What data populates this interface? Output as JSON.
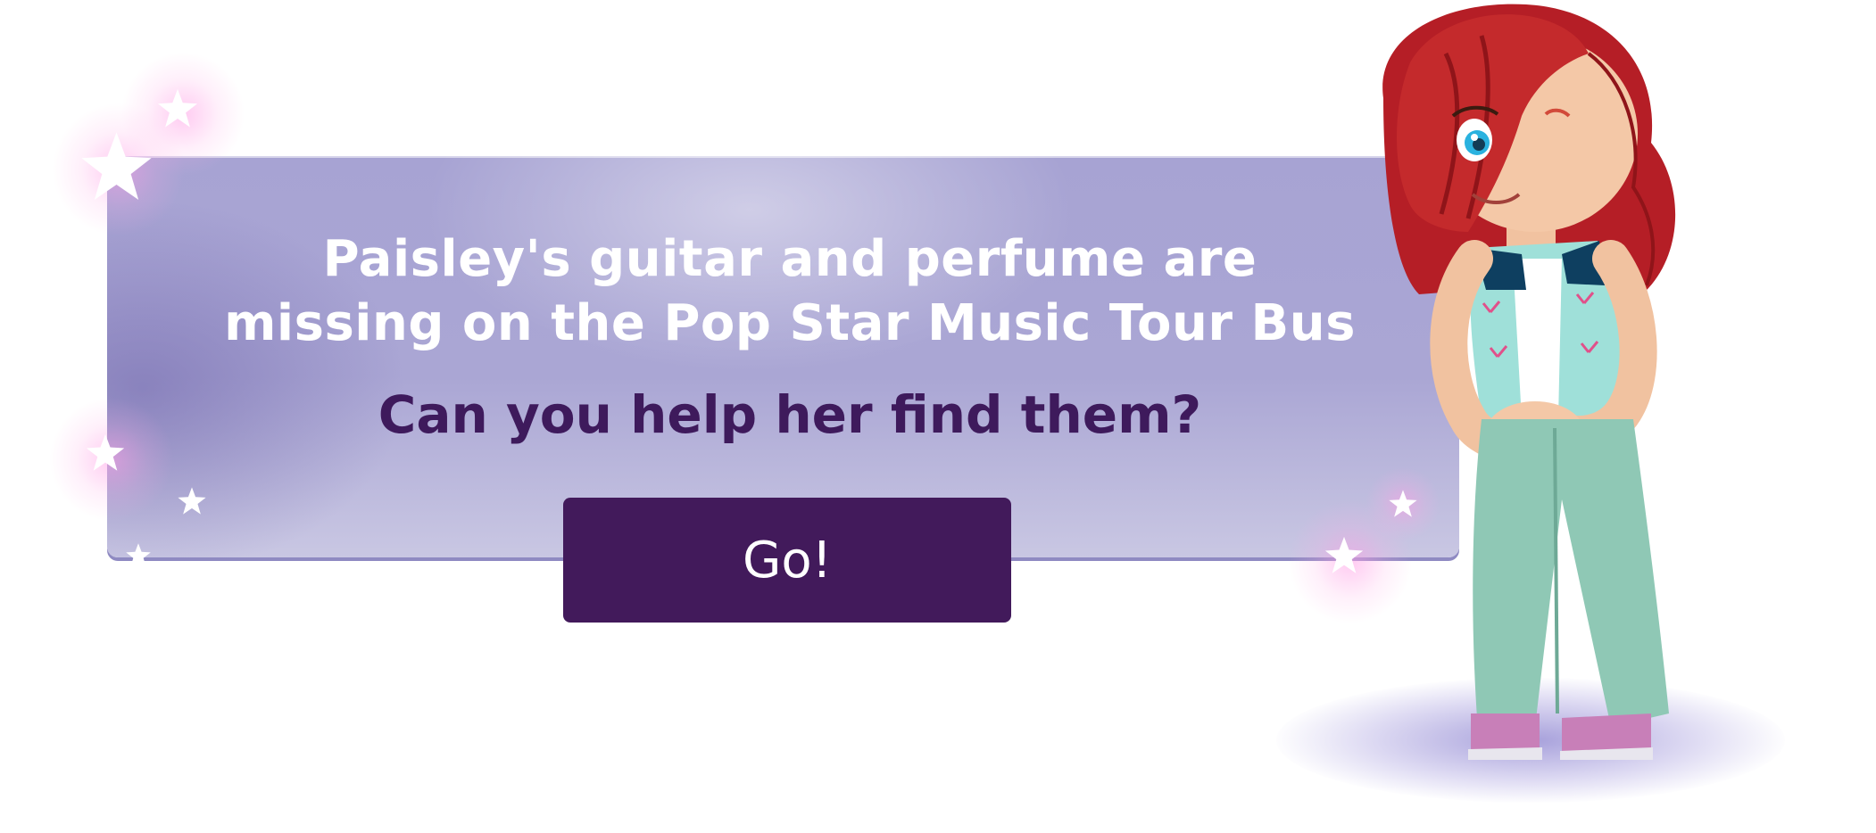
{
  "banner": {
    "headline_line1": "Paisley's guitar and perfume are",
    "headline_line2": "missing on the Pop Star Music Tour Bus",
    "question": "Can you help her find them?",
    "go_label": "Go!"
  },
  "colors": {
    "panel": "#aaa6d4",
    "headline": "#ffffff",
    "question": "#3e1a5c",
    "button": "#421a5b",
    "button_text": "#ffffff"
  },
  "icons": {
    "sparkles": "star-icon",
    "character": "paisley-character"
  }
}
